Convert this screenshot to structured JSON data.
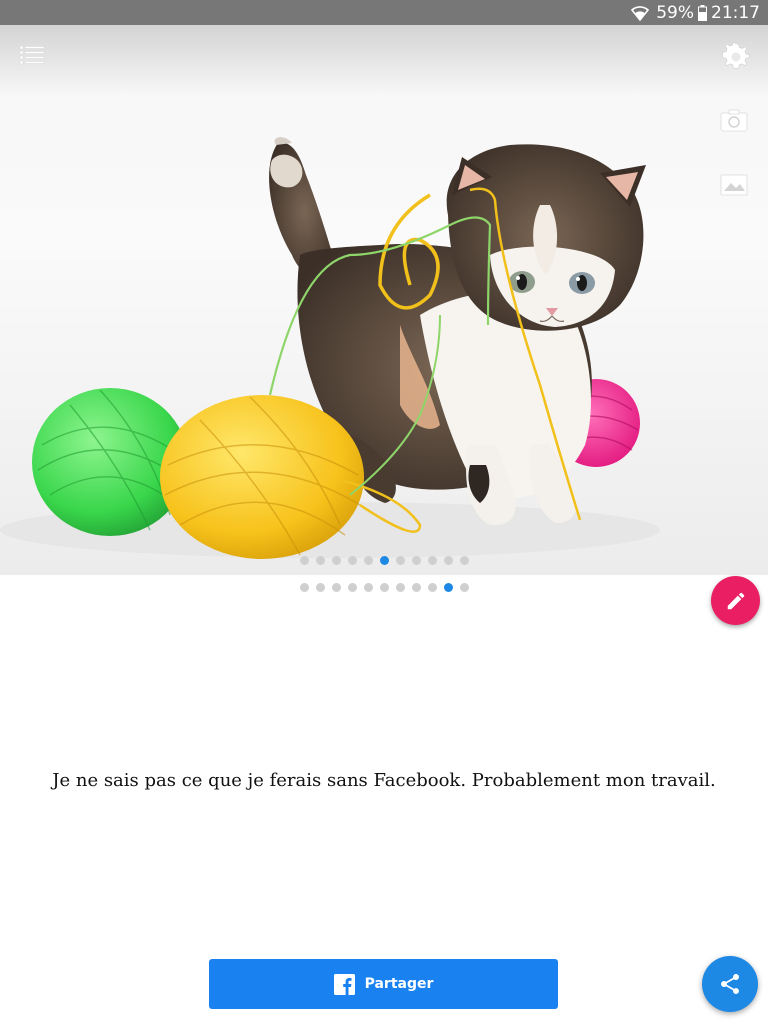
{
  "status_bar": {
    "battery_percent": "59%",
    "time": "21:17",
    "icons": [
      "wifi-icon",
      "battery-icon"
    ]
  },
  "toolbar": {
    "icons": [
      "menu-list-icon",
      "settings-gear-icon",
      "camera-icon",
      "gallery-image-icon"
    ]
  },
  "hero_image": {
    "subject": "kitten playing with balls of yarn (green, yellow, pink)"
  },
  "image_pager": {
    "count": 11,
    "active_index": 5
  },
  "text_pager": {
    "count": 11,
    "active_index": 9
  },
  "quote": {
    "text": "Je ne sais pas ce que je ferais sans Facebook. Probablement mon travail."
  },
  "share_button": {
    "label": "Partager",
    "icon": "facebook-icon"
  },
  "fabs": {
    "edit_icon": "pencil-icon",
    "share_icon": "share-icon"
  },
  "colors": {
    "accent_blue": "#1e88e5",
    "facebook_button": "#1a82f0",
    "edit_fab": "#e91e63",
    "status_bar": "#777777"
  }
}
